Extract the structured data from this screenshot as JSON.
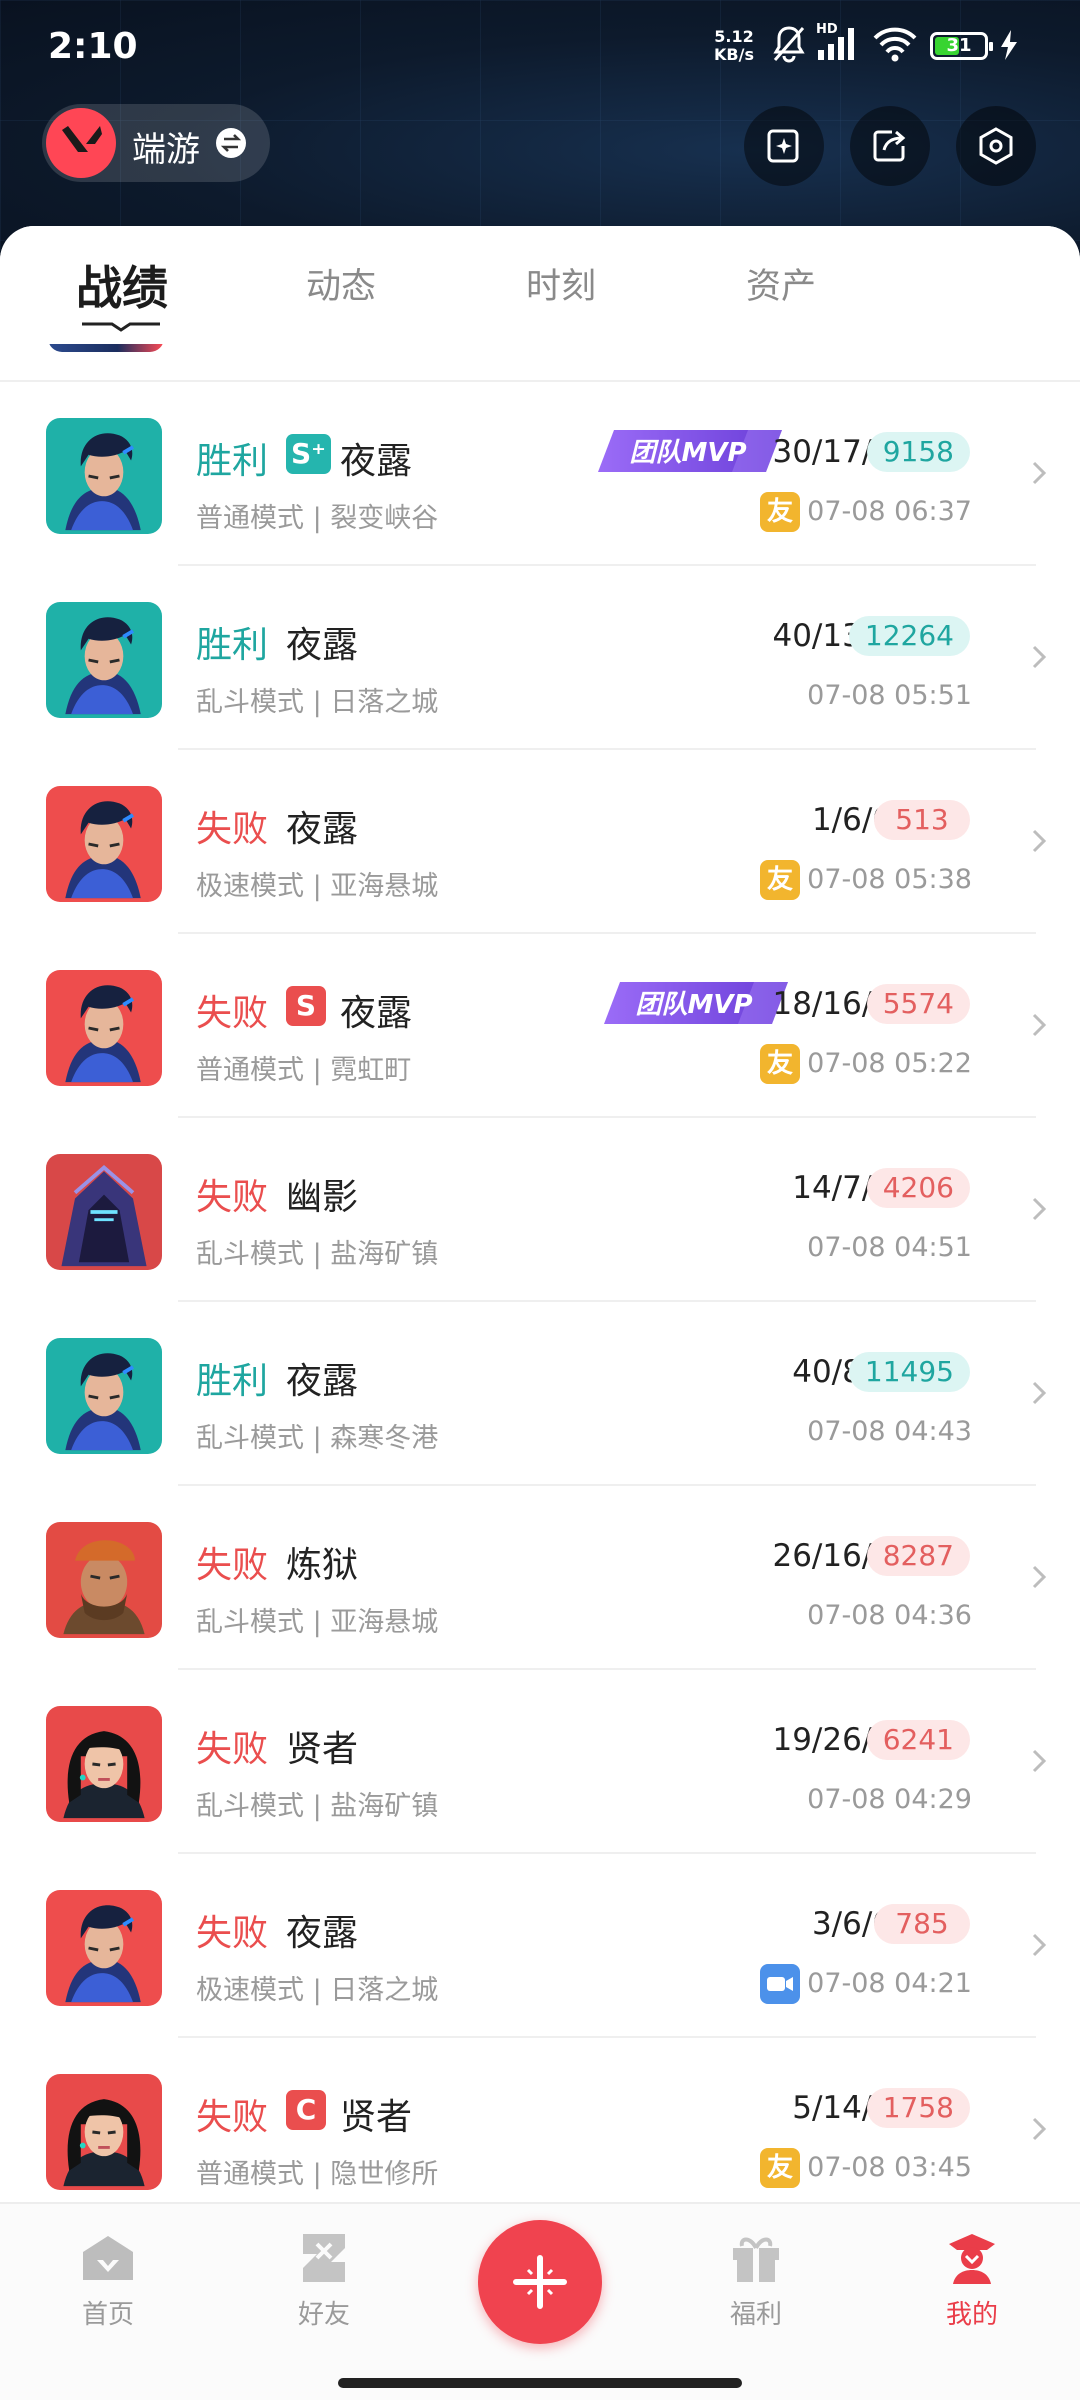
{
  "status_bar": {
    "time": "2:10",
    "net_speed_value": "5.12",
    "net_speed_unit": "KB/s",
    "signal_label": "HD",
    "battery": "31"
  },
  "header": {
    "account_name": "端游"
  },
  "tabs": [
    {
      "label": "战绩",
      "active": true
    },
    {
      "label": "动态",
      "active": false
    },
    {
      "label": "时刻",
      "active": false
    },
    {
      "label": "资产",
      "active": false
    }
  ],
  "matches": [
    {
      "result": "胜利",
      "outcome": "win",
      "rank": "S⁺",
      "agent": "夜露",
      "mvp": "团队MVP",
      "kda": "30/17/6",
      "score": "9158",
      "mode": "普通模式 | 裂变峡谷",
      "icon": "friend",
      "icon_label": "友",
      "date": "07-08 06:37",
      "portrait": "yoru-teal"
    },
    {
      "result": "胜利",
      "outcome": "win",
      "rank": "",
      "agent": "夜露",
      "mvp": "",
      "kda": "40/13/7",
      "score": "12264",
      "mode": "乱斗模式 | 日落之城",
      "icon": "",
      "icon_label": "",
      "date": "07-08 05:51",
      "portrait": "yoru-teal"
    },
    {
      "result": "失败",
      "outcome": "lose",
      "rank": "",
      "agent": "夜露",
      "mvp": "",
      "kda": "1/6/0",
      "score": "513",
      "mode": "极速模式 | 亚海悬城",
      "icon": "friend",
      "icon_label": "友",
      "date": "07-08 05:38",
      "portrait": "yoru-red"
    },
    {
      "result": "失败",
      "outcome": "lose",
      "rank": "S",
      "agent": "夜露",
      "mvp": "团队MVP",
      "kda": "18/16/7",
      "score": "5574",
      "mode": "普通模式 | 霓虹町",
      "icon": "friend",
      "icon_label": "友",
      "date": "07-08 05:22",
      "portrait": "yoru-red"
    },
    {
      "result": "失败",
      "outcome": "lose",
      "rank": "",
      "agent": "幽影",
      "mvp": "",
      "kda": "14/7/2",
      "score": "4206",
      "mode": "乱斗模式 | 盐海矿镇",
      "icon": "",
      "icon_label": "",
      "date": "07-08 04:51",
      "portrait": "omen"
    },
    {
      "result": "胜利",
      "outcome": "win",
      "rank": "",
      "agent": "夜露",
      "mvp": "",
      "kda": "40/8/2",
      "score": "11495",
      "mode": "乱斗模式 | 森寒冬港",
      "icon": "",
      "icon_label": "",
      "date": "07-08 04:43",
      "portrait": "yoru-teal"
    },
    {
      "result": "失败",
      "outcome": "lose",
      "rank": "",
      "agent": "炼狱",
      "mvp": "",
      "kda": "26/16/7",
      "score": "8287",
      "mode": "乱斗模式 | 亚海悬城",
      "icon": "",
      "icon_label": "",
      "date": "07-08 04:36",
      "portrait": "brimstone"
    },
    {
      "result": "失败",
      "outcome": "lose",
      "rank": "",
      "agent": "贤者",
      "mvp": "",
      "kda": "19/26/8",
      "score": "6241",
      "mode": "乱斗模式 | 盐海矿镇",
      "icon": "",
      "icon_label": "",
      "date": "07-08 04:29",
      "portrait": "sage"
    },
    {
      "result": "失败",
      "outcome": "lose",
      "rank": "",
      "agent": "夜露",
      "mvp": "",
      "kda": "3/6/0",
      "score": "785",
      "mode": "极速模式 | 日落之城",
      "icon": "video",
      "icon_label": "",
      "date": "07-08 04:21",
      "portrait": "yoru-red"
    },
    {
      "result": "失败",
      "outcome": "lose",
      "rank": "C",
      "agent": "贤者",
      "mvp": "",
      "kda": "5/14/2",
      "score": "1758",
      "mode": "普通模式 | 隐世修所",
      "icon": "friend",
      "icon_label": "友",
      "date": "07-08 03:45",
      "portrait": "sage"
    }
  ],
  "bottom_nav": [
    {
      "label": "首页",
      "icon": "home-icon",
      "active": false
    },
    {
      "label": "好友",
      "icon": "friends-icon",
      "active": false
    },
    {
      "label": "福利",
      "icon": "gift-icon",
      "active": false
    },
    {
      "label": "我的",
      "icon": "profile-icon",
      "active": true
    }
  ],
  "colors": {
    "win": "#1fa6a0",
    "lose": "#ea4e4e",
    "accent": "#f0434f",
    "mvp_purple": "#7b4fe0",
    "friend_badge": "#f2b52e",
    "video_badge": "#4c91ea"
  }
}
